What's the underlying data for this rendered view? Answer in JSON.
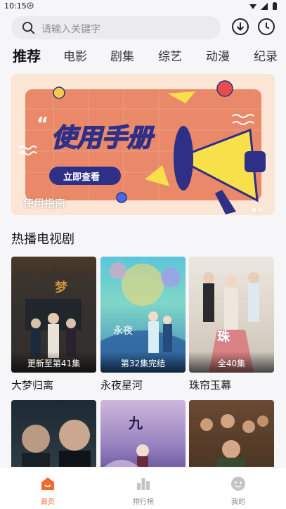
{
  "status_bar": {
    "time": "10:15"
  },
  "search": {
    "placeholder": "请输入关键字"
  },
  "header": {
    "download_icon": "download-icon",
    "history_icon": "clock-icon"
  },
  "tabs": [
    {
      "label": "推荐",
      "active": true
    },
    {
      "label": "电影"
    },
    {
      "label": "剧集"
    },
    {
      "label": "综艺"
    },
    {
      "label": "动漫"
    },
    {
      "label": "纪录"
    }
  ],
  "banner": {
    "headline": "使用手册",
    "button_text": "立即查看",
    "caption": "使用指南",
    "page_index": 1,
    "page_count": 2
  },
  "section": {
    "title": "热播电视剧"
  },
  "dramas": [
    {
      "title": "大梦归离",
      "badge": "更新至第41集"
    },
    {
      "title": "永夜星河",
      "badge": "第32集完结"
    },
    {
      "title": "珠帘玉幕",
      "badge": "全40集"
    }
  ],
  "bottom_nav": [
    {
      "label": "首页",
      "active": true,
      "icon": "home-icon"
    },
    {
      "label": "排行榜",
      "icon": "ranking-icon"
    },
    {
      "label": "我的",
      "icon": "profile-icon"
    }
  ],
  "colors": {
    "accent": "#f26a2a",
    "banner_bg": "#fbe5d5",
    "banner_panel": "#e9896a",
    "button_blue": "#2e2f86"
  }
}
